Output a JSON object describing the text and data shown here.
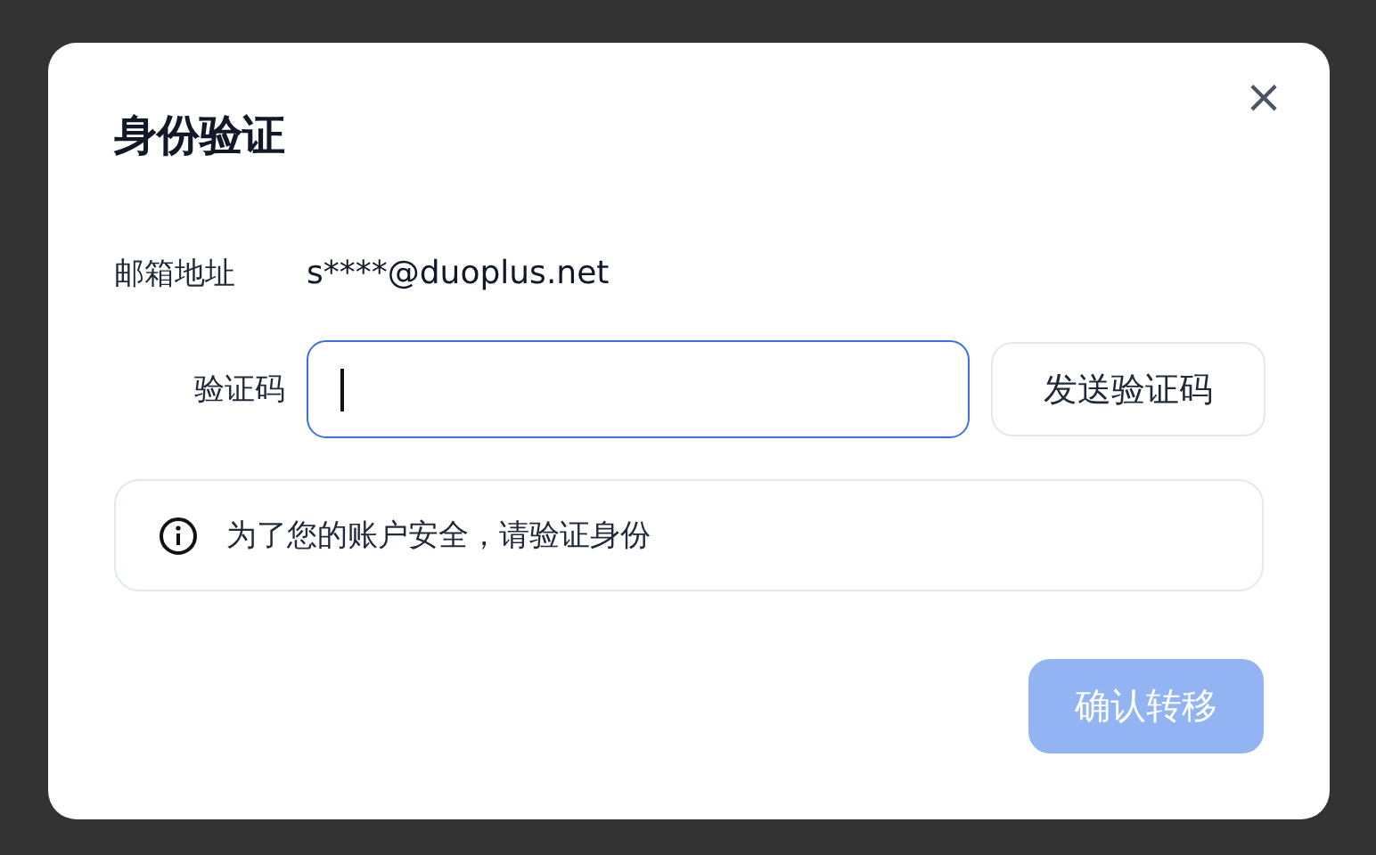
{
  "dialog": {
    "title": "身份验证",
    "close": "×",
    "email": {
      "label": "邮箱地址",
      "value": "s****@duoplus.net"
    },
    "code": {
      "label": "验证码",
      "focused": true,
      "send_button": "发送验证码"
    },
    "notice": "为了您的账户安全，请验证身份",
    "confirm": {
      "label": "确认转移",
      "disabled": true
    }
  }
}
